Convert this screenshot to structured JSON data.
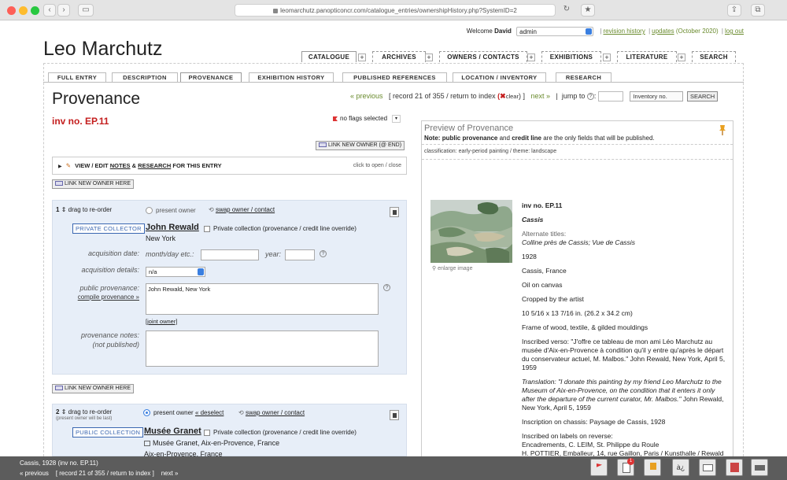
{
  "browser": {
    "url": "leomarchutz.panopticoncr.com/catalogue_entries/ownershipHistory.php?SystemID=2"
  },
  "header": {
    "welcome_label": "Welcome",
    "user_name": "David",
    "user_select": "admin",
    "revision_history": "revision history",
    "updates": "updates",
    "updates_date": "(October 2020)",
    "log_out": "log out",
    "logo": "Leo Marchutz"
  },
  "main_tabs": [
    "CATALOGUE",
    "ARCHIVES",
    "OWNERS / CONTACTS",
    "EXHIBITIONS",
    "LITERATURE",
    "SEARCH"
  ],
  "sub_tabs": [
    "FULL ENTRY",
    "DESCRIPTION",
    "PROVENANCE",
    "EXHIBITION HISTORY",
    "PUBLISHED REFERENCES",
    "LOCATION / INVENTORY",
    "RESEARCH"
  ],
  "page": {
    "title": "Provenance",
    "inv_no": "inv no. EP.11",
    "flags_text": "no flags selected",
    "link_new_owner_end": "LINK NEW OWNER (@ END)",
    "link_new_owner_here": "LINK NEW OWNER HERE",
    "view_edit_prefix": "VIEW / EDIT",
    "view_edit_notes": "NOTES",
    "view_edit_and": "&",
    "view_edit_research": "RESEARCH",
    "view_edit_suffix": "FOR THIS ENTRY",
    "click_open_close": "click to open / close"
  },
  "record_nav": {
    "previous": "« previous",
    "record_prefix": "[ record 21 of 355 /",
    "return_to_index": "return to index",
    "clear_x": "(✖",
    "clear": "clear",
    "close_bracket": ") ]",
    "next": "next »",
    "jump_to": "jump to",
    "jump_select": "Inventory no.",
    "search_btn": "SEARCH"
  },
  "owner1": {
    "number": "1",
    "drag": "drag to re-order",
    "present_owner": "present owner",
    "swap": "swap owner / contact",
    "type": "PRIVATE COLLECTOR",
    "name": "John Rewald",
    "private_collection": "Private collection (provenance / credit line override)",
    "location": "New York",
    "acq_date_label": "acquisition date:",
    "month_day_label": "month/day etc.:",
    "year_label": "year:",
    "acq_details_label": "acquisition details:",
    "acq_details_value": "n/a",
    "public_prov_label": "public provenance:",
    "compile_prov": "compile provenance »",
    "public_prov_value": "John Rewald, New York",
    "joint_owner": "[joint owner]",
    "prov_notes_label": "provenance notes:",
    "prov_notes_label2": "(not published)"
  },
  "owner2": {
    "number": "2",
    "drag": "drag to re-order",
    "drag_note": "(present owner will be last)",
    "present_owner": "present owner",
    "deselect": "« deselect",
    "swap": "swap owner / contact",
    "type": "PUBLIC COLLECTION",
    "name": "Musée Granet",
    "private_collection": "Private collection (provenance / credit line override)",
    "line1": "Musée Granet, Aix-en-Provence, France",
    "line2": "Aix-en-Provence, France"
  },
  "preview": {
    "title": "Preview of Provenance",
    "note_prefix": "Note:",
    "note_b1": "public provenance",
    "note_and": "and",
    "note_b2": "credit line",
    "note_suffix": "are the only fields that will be published.",
    "classification": "classification: early-period painting  /  theme: landscape",
    "enlarge": "enlarge image",
    "inv": "inv no. EP.11",
    "title_work": "Cassis",
    "alt_label": "Alternate titles:",
    "alt_value": "Colline près de Cassis; Vue de Cassis",
    "year": "1928",
    "place": "Cassis, France",
    "medium": "Oil on canvas",
    "cropped": "Cropped by the artist",
    "dims": "10 5/16 x 13 7/16 in. (26.2 x 34.2 cm)",
    "frame": "Frame of wood, textile, & gilded mouldings",
    "inscribed_verso": "Inscribed verso: \"J'offre ce tableau de mon ami Léo Marchutz au musée d'Aix-en-Provence à condition qu'il y entre qu'après le départ du conservateur actuel, M. Malbos.\" John Rewald, New York, April 5, 1959",
    "translation_it": "Translation: \"I donate this painting by my friend Leo Marchutz to the Museum of Aix-en-Provence, on the condition that it enters it only after the departure of the current curator, Mr. Malbos.\"",
    "translation_rest": " John Rewald, New York, April 5, 1959",
    "chassis": "Inscription on chassis: Paysage de Cassis, 1928",
    "labels_head": "Inscribed on labels on reverse:",
    "labels_1": "Encadrements, C. LEIM, St. Philippe du Roule",
    "labels_2": "H. POTTIER, Emballeur, 14, rue Gaillon, Paris / Kunsthalle / Rewald"
  },
  "bottom": {
    "line1": "Cassis, 1928 (inv no. EP.11)",
    "previous": "« previous",
    "record": "[ record 21 of 355 /",
    "return_to_index": "return to index",
    "close_bracket": "]",
    "next": "next »",
    "badge": "1"
  }
}
